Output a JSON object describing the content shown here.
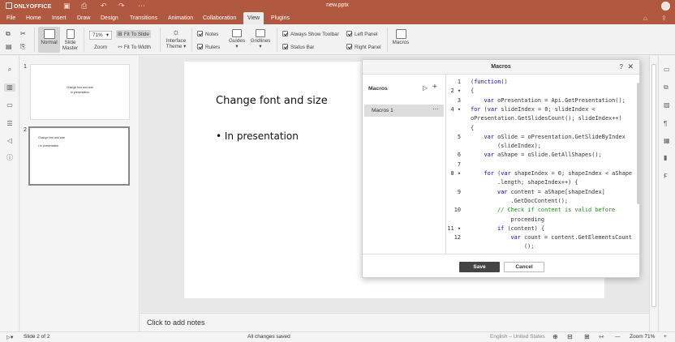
{
  "app": {
    "brand": "ONLYOFFICE",
    "document_title": "new.pptx"
  },
  "menu_tabs": [
    "File",
    "Home",
    "Insert",
    "Draw",
    "Design",
    "Transitions",
    "Animation",
    "Collaboration",
    "View",
    "Plugins"
  ],
  "active_tab": "View",
  "ribbon": {
    "normal": "Normal",
    "slide_master": "Slide Master",
    "zoom_value": "71%",
    "zoom": "Zoom",
    "fit_to_slide": "Fit To Slide",
    "fit_to_width": "Fit To Width",
    "interface_theme": "Interface Theme",
    "notes": "Notes",
    "rulers": "Rulers",
    "guides": "Guides",
    "gridlines": "Gridlines",
    "always_show_toolbar": "Always Show Toolbar",
    "status_bar": "Status Bar",
    "left_panel": "Left Panel",
    "right_panel": "Right Panel",
    "macros": "Macros",
    "checks": {
      "notes": true,
      "rulers": true,
      "always_show_toolbar": true,
      "status_bar": true,
      "left_panel": true,
      "right_panel": true
    }
  },
  "thumbnails": [
    {
      "number": "1",
      "title": "Change font and size",
      "bullet": "In presentation"
    },
    {
      "number": "2",
      "title": "Change font and size",
      "bullet": "• In presentation"
    }
  ],
  "slide": {
    "title": "Change font and size",
    "bullet": "• In presentation"
  },
  "notes_placeholder": "Click to add notes",
  "status": {
    "slide_of": "Slide 2 of 2",
    "saved": "All changes saved",
    "language": "English – United States",
    "zoom": "Zoom 71%"
  },
  "macros_dialog": {
    "title": "Macros",
    "list_label": "Macros",
    "items": [
      "Macros 1"
    ],
    "save": "Save",
    "cancel": "Cancel",
    "code_lines": [
      {
        "n": "1",
        "fold": "",
        "indent": 0,
        "text": "(function()"
      },
      {
        "n": "2",
        "fold": "▾",
        "indent": 0,
        "text": "{"
      },
      {
        "n": "3",
        "fold": "",
        "indent": 1,
        "text": "var oPresentation = Api.GetPresentation();"
      },
      {
        "n": "4",
        "fold": "▾",
        "indent": 0,
        "text": "for (var slideIndex = 0; slideIndex <"
      },
      {
        "n": "",
        "fold": "",
        "indent": 0,
        "text": "oPresentation.GetSlidesCount(); slideIndex++)"
      },
      {
        "n": "",
        "fold": "",
        "indent": 0,
        "text": "{"
      },
      {
        "n": "5",
        "fold": "",
        "indent": 1,
        "text": "var oSlide = oPresentation.GetSlideByIndex"
      },
      {
        "n": "",
        "fold": "",
        "indent": 2,
        "text": "(slideIndex);"
      },
      {
        "n": "6",
        "fold": "",
        "indent": 1,
        "text": "var aShape = oSlide.GetAllShapes();"
      },
      {
        "n": "7",
        "fold": "",
        "indent": 0,
        "text": ""
      },
      {
        "n": "8",
        "fold": "▾",
        "indent": 1,
        "text": "for (var shapeIndex = 0; shapeIndex < aShape"
      },
      {
        "n": "",
        "fold": "",
        "indent": 2,
        "text": ".length; shapeIndex++) {"
      },
      {
        "n": "9",
        "fold": "",
        "indent": 2,
        "text": "var content = aShape[shapeIndex]"
      },
      {
        "n": "",
        "fold": "",
        "indent": 3,
        "text": ".GetDocContent();"
      },
      {
        "n": "10",
        "fold": "",
        "indent": 2,
        "text": "// Check if content is valid before"
      },
      {
        "n": "",
        "fold": "",
        "indent": 3,
        "text": "proceeding"
      },
      {
        "n": "11",
        "fold": "▾",
        "indent": 2,
        "text": "if (content) {"
      },
      {
        "n": "12",
        "fold": "",
        "indent": 3,
        "text": "var count = content.GetElementsCount"
      },
      {
        "n": "",
        "fold": "",
        "indent": 4,
        "text": "();"
      }
    ]
  },
  "colors": {
    "brand": "#b15840",
    "keyword": "#0000cc",
    "comment": "#268b26"
  }
}
